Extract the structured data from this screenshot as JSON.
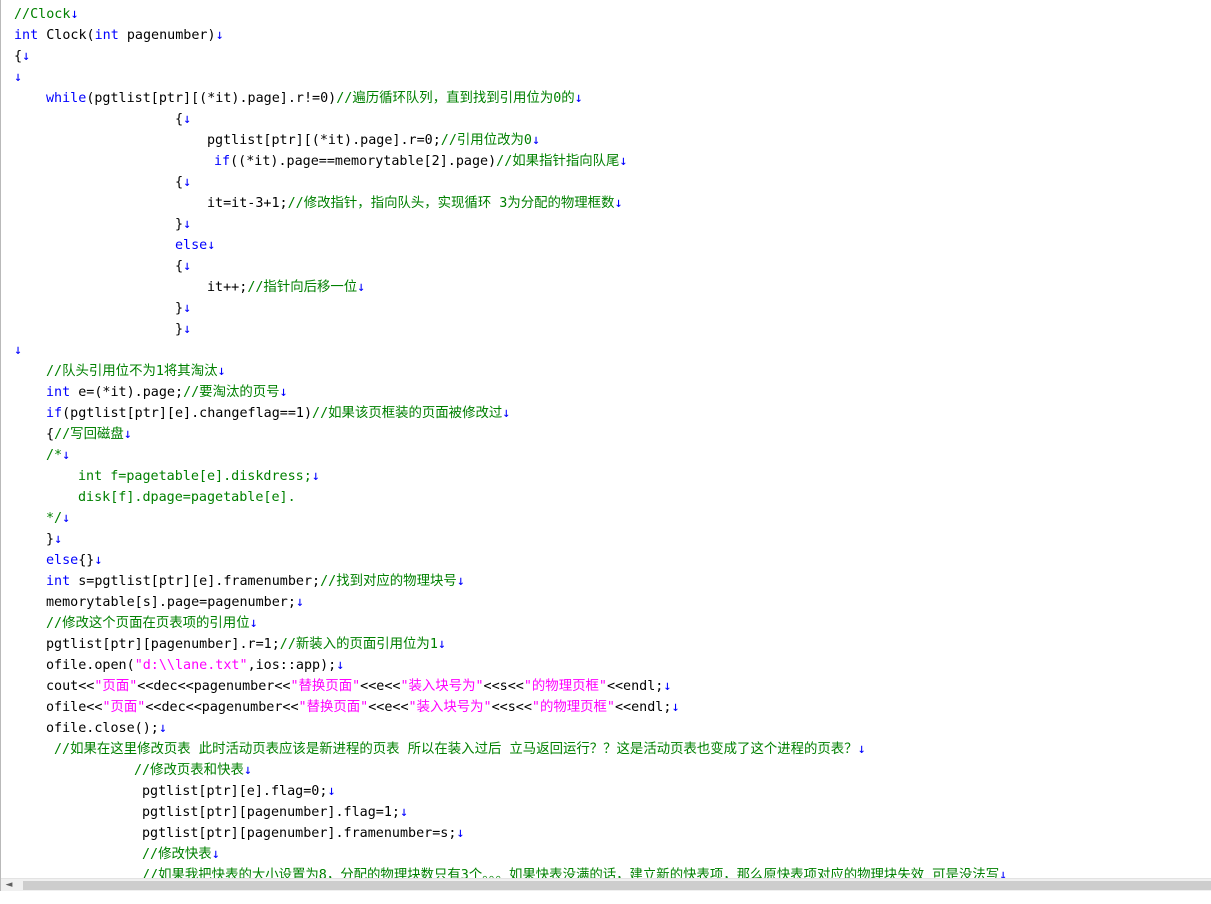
{
  "editor": {
    "lines": [
      {
        "indent": 0,
        "tokens": [
          {
            "t": "//Clock",
            "c": "comment"
          }
        ]
      },
      {
        "indent": 0,
        "tokens": [
          {
            "t": "int",
            "c": "blue"
          },
          {
            "t": " Clock(",
            "c": "plain"
          },
          {
            "t": "int",
            "c": "blue"
          },
          {
            "t": " pagenumber)",
            "c": "plain"
          }
        ]
      },
      {
        "indent": 0,
        "tokens": [
          {
            "t": "{",
            "c": "plain"
          }
        ]
      },
      {
        "indent": 0,
        "tokens": []
      },
      {
        "indent": 32,
        "tokens": [
          {
            "t": "while",
            "c": "blue"
          },
          {
            "t": "(pgtlist[ptr][(*it).page].r!=0)",
            "c": "plain"
          },
          {
            "t": "//遍历循环队列，直到找到引用位为0的",
            "c": "comment"
          }
        ]
      },
      {
        "indent": 161,
        "tokens": [
          {
            "t": "{",
            "c": "plain"
          }
        ]
      },
      {
        "indent": 193,
        "tokens": [
          {
            "t": "pgtlist[ptr][(*it).page].r=0;",
            "c": "plain"
          },
          {
            "t": "//引用位改为0",
            "c": "comment"
          }
        ]
      },
      {
        "indent": 200,
        "tokens": [
          {
            "t": "if",
            "c": "blue"
          },
          {
            "t": "((*it).page==memorytable[2].page)",
            "c": "plain"
          },
          {
            "t": "//如果指针指向队尾",
            "c": "comment"
          }
        ]
      },
      {
        "indent": 161,
        "tokens": [
          {
            "t": "{",
            "c": "plain"
          }
        ]
      },
      {
        "indent": 193,
        "tokens": [
          {
            "t": "it=it-3+1;",
            "c": "plain"
          },
          {
            "t": "//修改指针，指向队头，实现循环 3为分配的物理框数",
            "c": "comment"
          }
        ]
      },
      {
        "indent": 161,
        "tokens": [
          {
            "t": "}",
            "c": "plain"
          }
        ]
      },
      {
        "indent": 161,
        "tokens": [
          {
            "t": "else",
            "c": "blue"
          }
        ]
      },
      {
        "indent": 161,
        "tokens": [
          {
            "t": "{",
            "c": "plain"
          }
        ]
      },
      {
        "indent": 193,
        "tokens": [
          {
            "t": "it++;",
            "c": "plain"
          },
          {
            "t": "//指针向后移一位",
            "c": "comment"
          }
        ]
      },
      {
        "indent": 161,
        "tokens": [
          {
            "t": "}",
            "c": "plain"
          }
        ]
      },
      {
        "indent": 161,
        "tokens": [
          {
            "t": "}",
            "c": "plain"
          }
        ]
      },
      {
        "indent": 0,
        "tokens": []
      },
      {
        "indent": 32,
        "tokens": [
          {
            "t": "//队头引用位不为1将其淘汰",
            "c": "comment"
          }
        ]
      },
      {
        "indent": 32,
        "tokens": [
          {
            "t": "int",
            "c": "blue"
          },
          {
            "t": " e=(*it).page;",
            "c": "plain"
          },
          {
            "t": "//要淘汰的页号",
            "c": "comment"
          }
        ]
      },
      {
        "indent": 32,
        "tokens": [
          {
            "t": "if",
            "c": "blue"
          },
          {
            "t": "(pgtlist[ptr][e].changeflag==1)",
            "c": "plain"
          },
          {
            "t": "//如果该页框装的页面被修改过",
            "c": "comment"
          }
        ]
      },
      {
        "indent": 32,
        "tokens": [
          {
            "t": "{",
            "c": "plain"
          },
          {
            "t": "//写回磁盘",
            "c": "comment"
          }
        ]
      },
      {
        "indent": 32,
        "tokens": [
          {
            "t": "/*",
            "c": "comment"
          }
        ]
      },
      {
        "indent": 64,
        "tokens": [
          {
            "t": "int f=pagetable[e].diskdress;",
            "c": "comment"
          }
        ]
      },
      {
        "indent": 64,
        "tokens": [
          {
            "t": "disk[f].dpage=pagetable[e].",
            "c": "comment"
          }
        ],
        "nomark": true
      },
      {
        "indent": 32,
        "tokens": [
          {
            "t": "*/",
            "c": "comment"
          }
        ]
      },
      {
        "indent": 32,
        "tokens": [
          {
            "t": "}",
            "c": "plain"
          }
        ]
      },
      {
        "indent": 32,
        "tokens": [
          {
            "t": "else",
            "c": "blue"
          },
          {
            "t": "{}",
            "c": "plain"
          }
        ]
      },
      {
        "indent": 32,
        "tokens": [
          {
            "t": "int",
            "c": "blue"
          },
          {
            "t": " s=pgtlist[ptr][e].framenumber;",
            "c": "plain"
          },
          {
            "t": "//找到对应的物理块号",
            "c": "comment"
          }
        ]
      },
      {
        "indent": 32,
        "tokens": [
          {
            "t": "memorytable[s].page=pagenumber;",
            "c": "plain"
          }
        ]
      },
      {
        "indent": 32,
        "tokens": [
          {
            "t": "//修改这个页面在页表项的引用位",
            "c": "comment"
          }
        ]
      },
      {
        "indent": 32,
        "tokens": [
          {
            "t": "pgtlist[ptr][pagenumber].r=1;",
            "c": "plain"
          },
          {
            "t": "//新装入的页面引用位为1",
            "c": "comment"
          }
        ]
      },
      {
        "indent": 32,
        "tokens": [
          {
            "t": "ofile.open(",
            "c": "plain"
          },
          {
            "t": "\"d:\\\\lane.txt\"",
            "c": "string"
          },
          {
            "t": ",ios::app);",
            "c": "plain"
          }
        ]
      },
      {
        "indent": 32,
        "tokens": [
          {
            "t": "cout<<",
            "c": "plain"
          },
          {
            "t": "\"页面\"",
            "c": "string"
          },
          {
            "t": "<<dec<<pagenumber<<",
            "c": "plain"
          },
          {
            "t": "\"替换页面\"",
            "c": "string"
          },
          {
            "t": "<<e<<",
            "c": "plain"
          },
          {
            "t": "\"装入块号为\"",
            "c": "string"
          },
          {
            "t": "<<s<<",
            "c": "plain"
          },
          {
            "t": "\"的物理页框\"",
            "c": "string"
          },
          {
            "t": "<<endl;",
            "c": "plain"
          }
        ]
      },
      {
        "indent": 32,
        "tokens": [
          {
            "t": "ofile<<",
            "c": "plain"
          },
          {
            "t": "\"页面\"",
            "c": "string"
          },
          {
            "t": "<<dec<<pagenumber<<",
            "c": "plain"
          },
          {
            "t": "\"替换页面\"",
            "c": "string"
          },
          {
            "t": "<<e<<",
            "c": "plain"
          },
          {
            "t": "\"装入块号为\"",
            "c": "string"
          },
          {
            "t": "<<s<<",
            "c": "plain"
          },
          {
            "t": "\"的物理页框\"",
            "c": "string"
          },
          {
            "t": "<<endl;",
            "c": "plain"
          }
        ]
      },
      {
        "indent": 32,
        "tokens": [
          {
            "t": "ofile.close();",
            "c": "plain"
          }
        ]
      },
      {
        "indent": 40,
        "tokens": [
          {
            "t": "//如果在这里修改页表 此时活动页表应该是新进程的页表 所以在装入过后 立马返回运行？？这是活动页表也变成了这个进程的页表？",
            "c": "comment"
          }
        ]
      },
      {
        "indent": 120,
        "tokens": [
          {
            "t": "//修改页表和快表",
            "c": "comment"
          }
        ]
      },
      {
        "indent": 128,
        "tokens": [
          {
            "t": "pgtlist[ptr][e].flag=0;",
            "c": "plain"
          }
        ]
      },
      {
        "indent": 128,
        "tokens": [
          {
            "t": "pgtlist[ptr][pagenumber].flag=1;",
            "c": "plain"
          }
        ]
      },
      {
        "indent": 128,
        "tokens": [
          {
            "t": "pgtlist[ptr][pagenumber].framenumber=s;",
            "c": "plain"
          }
        ]
      },
      {
        "indent": 128,
        "tokens": [
          {
            "t": "//修改快表",
            "c": "comment"
          }
        ]
      },
      {
        "indent": 128,
        "tokens": [
          {
            "t": "//如果我把快表的大小设置为8，分配的物理块数只有3个。。。如果快表没满的话，建立新的快表项，那么原快表项对应的物理块失效 可是没法写",
            "c": "comment"
          }
        ]
      }
    ],
    "line_end_mark": "↓"
  },
  "scrollbar": {
    "left_arrow": "◄"
  }
}
